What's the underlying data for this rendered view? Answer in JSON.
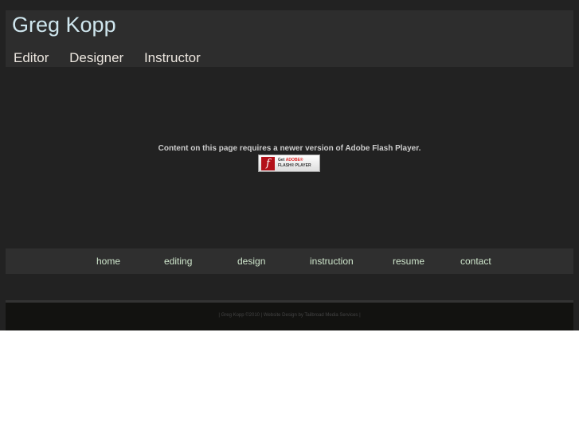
{
  "header": {
    "title": "Greg Kopp",
    "roles": [
      "Editor",
      "Designer",
      "Instructor"
    ]
  },
  "flash": {
    "message": "Content on this page requires a newer version of Adobe Flash Player.",
    "button_line1": "Get ",
    "button_brand": "ADOBE®",
    "button_line2": "FLASH® PLAYER"
  },
  "nav": [
    "home",
    "editing",
    "design",
    "instruction",
    "resume",
    "contact"
  ],
  "footer": {
    "credit": "|   Greg Kopp ©2010   |  Website Design by Tailbroad Media Services   |"
  }
}
